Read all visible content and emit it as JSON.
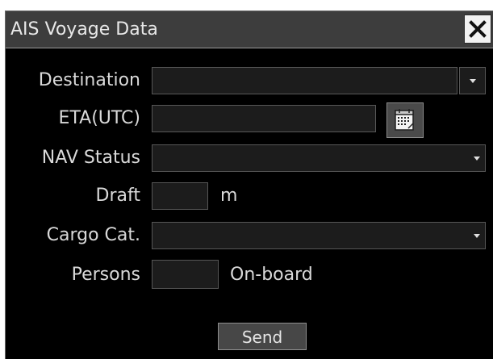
{
  "dialog": {
    "title": "AIS Voyage Data",
    "close_icon": "close-icon"
  },
  "form": {
    "destination": {
      "label": "Destination",
      "value": "",
      "icon": "chevron-down-icon"
    },
    "eta": {
      "label": "ETA(UTC)",
      "value": "",
      "icon": "calendar-icon"
    },
    "nav_status": {
      "label": "NAV Status",
      "value": "",
      "icon": "chevron-down-icon"
    },
    "draft": {
      "label": "Draft",
      "value": "",
      "unit": "m"
    },
    "cargo": {
      "label": "Cargo Cat.",
      "value": "",
      "icon": "chevron-down-icon"
    },
    "persons": {
      "label": "Persons",
      "value": "",
      "unit": "On-board"
    }
  },
  "actions": {
    "send_label": "Send"
  },
  "colors": {
    "background": "#000000",
    "titlebar": "#3d3d3d",
    "field": "#1c1c1c",
    "text": "#d9d9d9"
  }
}
